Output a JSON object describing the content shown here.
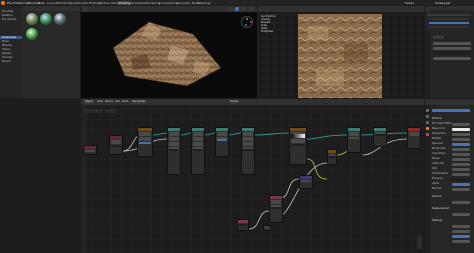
{
  "app": {
    "title": "Blender"
  },
  "menu": {
    "items": [
      "File",
      "Edit",
      "Render",
      "Window",
      "Help"
    ],
    "workspaces": [
      "Layout",
      "Modeling",
      "Sculpting",
      "UV Editing",
      "Texture Paint",
      "Shading",
      "Animation",
      "Rendering",
      "Compositing",
      "Geometry Nodes",
      "Scripting"
    ],
    "active_workspace": "Shading",
    "scene_label": "Scene",
    "view_layer_label": "ViewLayer"
  },
  "file_browser": {
    "rows": [
      "Favorites",
      "Desktop",
      "Documents",
      "Downloads",
      "Music",
      "Pictures",
      "Videos",
      "System",
      "Volumes",
      "Recent"
    ],
    "selected_index": 3
  },
  "image_editor": {
    "overlay_lines": [
      "Sun Direction",
      "Intensity",
      "Strength",
      "Scale",
      "Detail",
      "Roughness"
    ]
  },
  "node_editor": {
    "header": {
      "editor": "Object",
      "menus": [
        "View",
        "Select",
        "Add",
        "Node"
      ],
      "use_nodes": "Use Nodes",
      "material": "Terrain"
    }
  },
  "properties": {
    "sections": [
      "Surface",
      "Volume",
      "Displacement",
      "Settings"
    ],
    "labels": [
      "Surface",
      "Principled BSDF",
      "Base Color",
      "Subsurface",
      "Metallic",
      "Specular",
      "Roughness",
      "Anisotropic",
      "Sheen",
      "Clearcoat",
      "IOR",
      "Transmission",
      "Emission",
      "Alpha",
      "Normal",
      "Displacement",
      "Volume",
      "Settings"
    ]
  },
  "colors": {
    "accent": "#4772b3",
    "node_float": "#3d7a74",
    "node_color": "#6b4a1e",
    "node_input": "#7a3a4a",
    "node_output": "#8a2a2a",
    "link_teal": "#2fb0a0",
    "link_white": "#c8c8c8",
    "link_yellow": "#c8c040"
  }
}
